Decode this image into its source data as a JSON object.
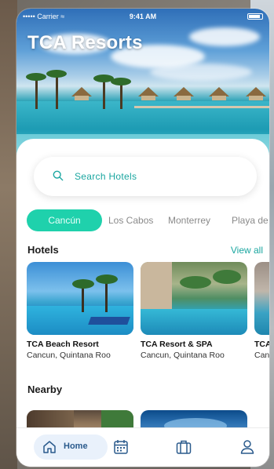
{
  "status_bar": {
    "carrier": "••••• Carrier ≈",
    "time": "9:41 AM"
  },
  "app": {
    "title": "TCA Resorts"
  },
  "search": {
    "placeholder": "Search Hotels"
  },
  "destinations": {
    "active": "Cancún",
    "items": [
      "Cancún",
      "Los Cabos",
      "Monterrey",
      "Playa de"
    ]
  },
  "hotels_section": {
    "title": "Hotels",
    "view_all": "View all",
    "cards": [
      {
        "name": "TCA Beach Resort",
        "location": "Cancun, Quintana Roo"
      },
      {
        "name": "TCA Resort & SPA",
        "location": "Cancun, Quintana Roo"
      },
      {
        "name": "TCA I",
        "location": "Canc"
      }
    ]
  },
  "nearby_section": {
    "title": "Nearby"
  },
  "bottom_nav": {
    "home_label": "Home",
    "icons": [
      "home-icon",
      "calendar-icon",
      "briefcase-icon",
      "user-icon"
    ],
    "accent": "#2a5a8c"
  },
  "colors": {
    "accent_teal": "#1aa6a0",
    "chip_active": "#1fd1ac"
  }
}
